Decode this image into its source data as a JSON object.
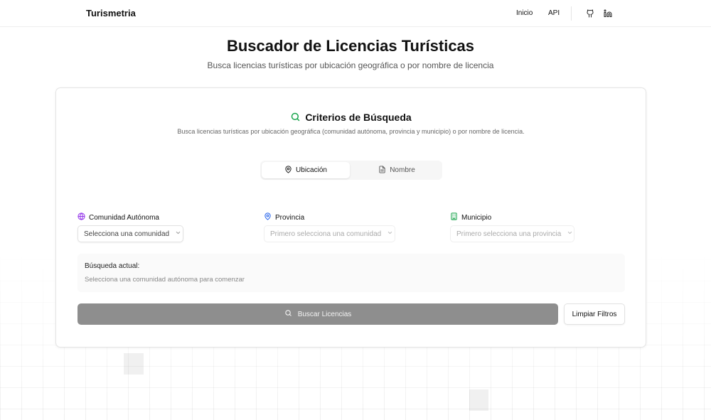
{
  "nav": {
    "brand": "Turismetria",
    "links": [
      "Inicio",
      "API"
    ],
    "icons": [
      "github-icon",
      "linkedin-icon"
    ]
  },
  "header": {
    "title": "Buscador de Licencias Turísticas",
    "subtitle": "Busca licencias turísticas por ubicación geográfica o por nombre de licencia"
  },
  "card": {
    "title": "Criterios de Búsqueda",
    "description": "Busca licencias turísticas por ubicación geográfica (comunidad autónoma, provincia y municipio) o por nombre de licencia.",
    "tabs": [
      {
        "label": "Ubicación",
        "icon": "map-pin-icon",
        "active": true
      },
      {
        "label": "Nombre",
        "icon": "document-icon",
        "active": false
      }
    ],
    "fields": [
      {
        "label": "Comunidad Autónoma",
        "icon": "globe-icon",
        "icon_color": "#9333ea",
        "placeholder": "Selecciona una comunidad",
        "enabled": true
      },
      {
        "label": "Provincia",
        "icon": "map-pin-icon",
        "icon_color": "#2563eb",
        "placeholder": "Primero selecciona una comunidad",
        "enabled": false
      },
      {
        "label": "Municipio",
        "icon": "building-icon",
        "icon_color": "#16a34a",
        "placeholder": "Primero selecciona una provincia",
        "enabled": false
      }
    ],
    "current_search": {
      "label": "Búsqueda actual:",
      "text": "Selecciona una comunidad autónoma para comenzar"
    },
    "search_button": "Buscar Licencias",
    "clear_button": "Limpiar Filtros"
  },
  "colors": {
    "accent_green": "#16a34a",
    "search_button_bg": "#8e8e8e"
  }
}
